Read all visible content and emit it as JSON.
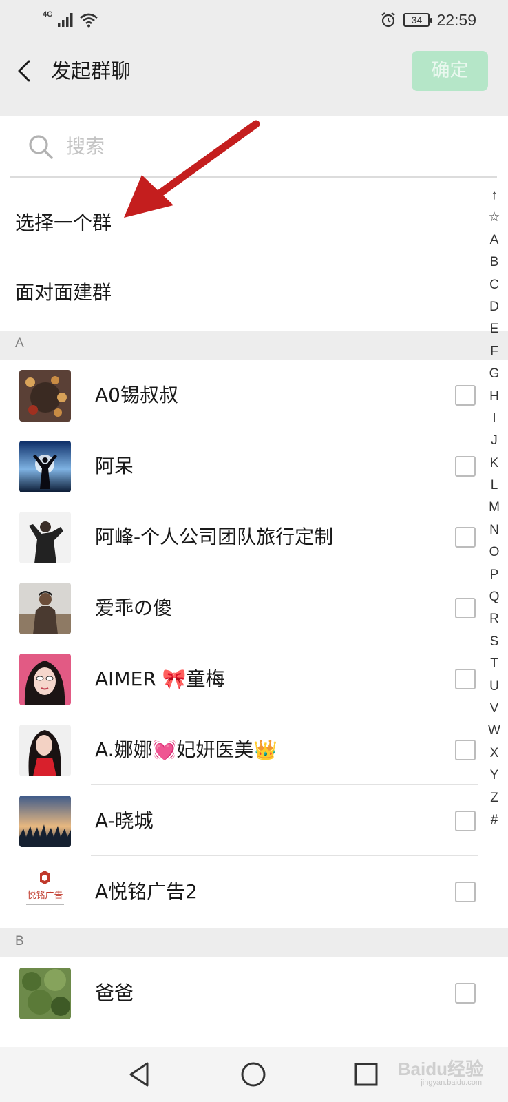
{
  "status_bar": {
    "network": "4G",
    "battery": "34",
    "time": "22:59",
    "icons": [
      "signal-icon",
      "wifi-icon",
      "alarm-icon",
      "battery-icon"
    ]
  },
  "header": {
    "title": "发起群聊",
    "confirm_label": "确定",
    "confirm_enabled": false,
    "back_icon": "back-chevron-icon"
  },
  "search": {
    "placeholder": "搜索",
    "value": ""
  },
  "menu": {
    "select_group": "选择一个群",
    "face_to_face": "面对面建群"
  },
  "sections": [
    {
      "letter": "A",
      "contacts": [
        {
          "name": "A0锡叔叔",
          "checked": false
        },
        {
          "name": "阿呆",
          "checked": false
        },
        {
          "name": "阿峰-个人公司团队旅行定制",
          "checked": false
        },
        {
          "name": "爱乖の傻",
          "checked": false
        },
        {
          "name": "AIMER 🎀童梅",
          "checked": false
        },
        {
          "name": "A.娜娜💓妃妍医美👑",
          "checked": false
        },
        {
          "name": "A-晓城",
          "checked": false
        },
        {
          "name": "A悦铭广告2",
          "checked": false
        }
      ]
    },
    {
      "letter": "B",
      "contacts": [
        {
          "name": "爸爸",
          "checked": false
        }
      ]
    }
  ],
  "avatar_logo_text": "悦铭广告",
  "index_letters": [
    "↑",
    "☆",
    "A",
    "B",
    "C",
    "D",
    "E",
    "F",
    "G",
    "H",
    "I",
    "J",
    "K",
    "L",
    "M",
    "N",
    "O",
    "P",
    "Q",
    "R",
    "S",
    "T",
    "U",
    "V",
    "W",
    "X",
    "Y",
    "Z",
    "#"
  ],
  "watermark": {
    "brand": "Baidu经验",
    "url": "jingyan.baidu.com"
  },
  "colors": {
    "accent_disabled": "#b5e6c8",
    "annotation_arrow": "#c41e1e",
    "background": "#ededed"
  }
}
